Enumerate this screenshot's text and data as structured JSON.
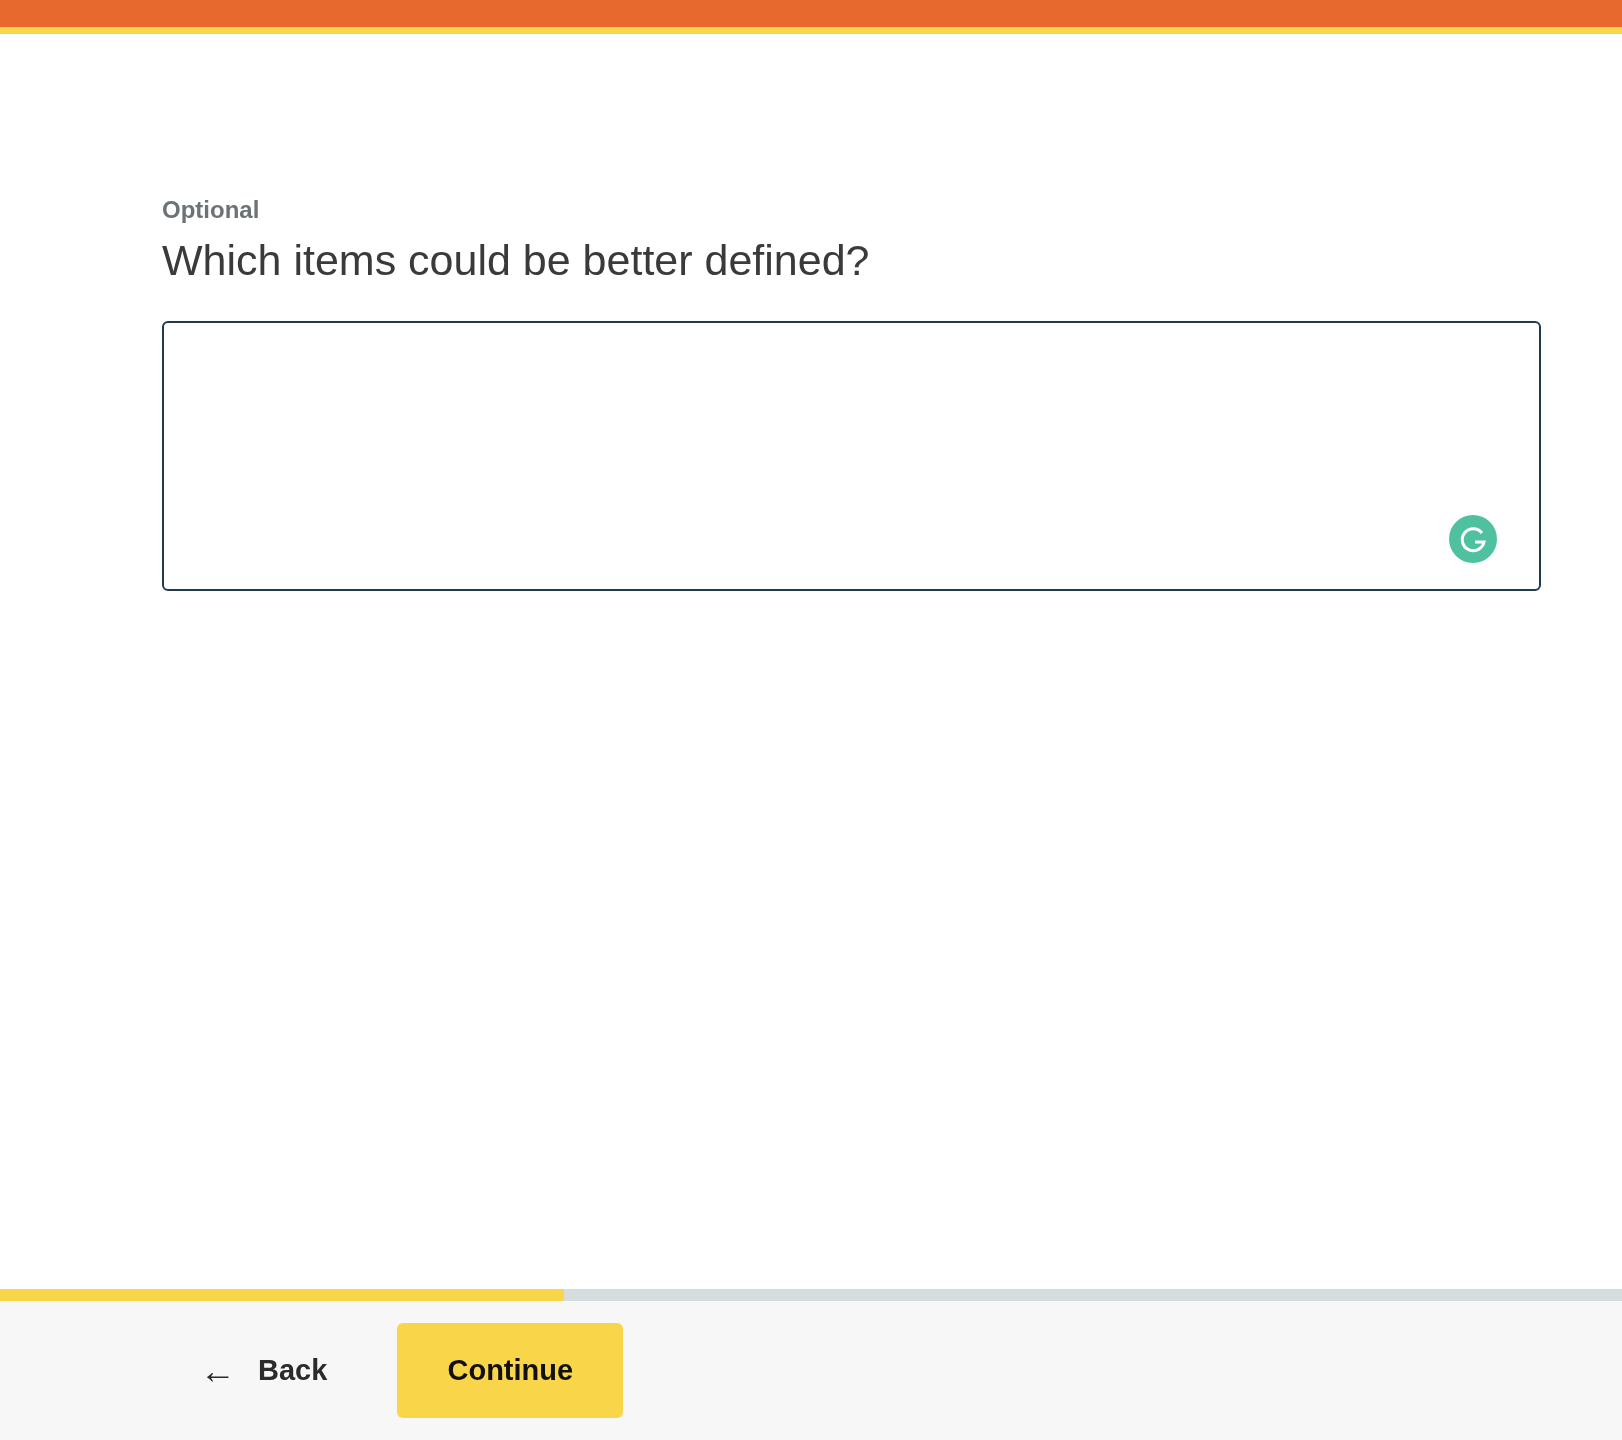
{
  "question": {
    "tag": "Optional",
    "title": "Which items could be better defined?"
  },
  "progress": {
    "level": 0.348
  },
  "footer": {
    "back": {
      "icon": "←",
      "label": "Back"
    },
    "continue": {
      "label": "Continue"
    }
  }
}
